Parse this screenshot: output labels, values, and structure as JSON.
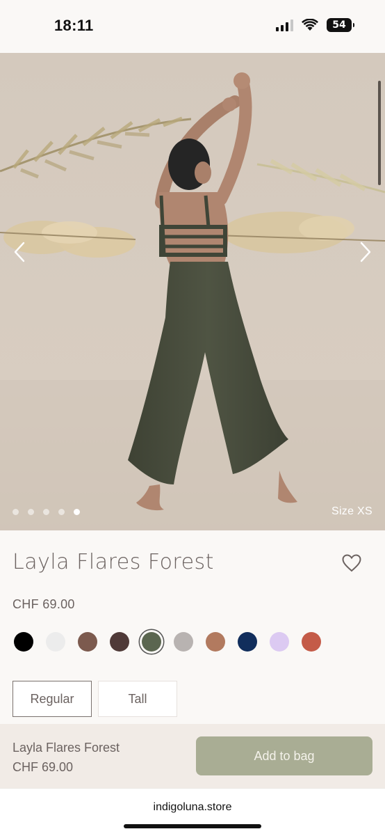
{
  "status_bar": {
    "time": "18:11",
    "battery_level": "54",
    "signal_icon": "cellular-signal-icon",
    "wifi_icon": "wifi-icon",
    "battery_icon": "battery-icon"
  },
  "gallery": {
    "size_label": "Size XS",
    "image_count": 5,
    "active_index": 4,
    "prev_icon": "chevron-left-icon",
    "next_icon": "chevron-right-icon"
  },
  "product": {
    "title": "Layla Flares Forest",
    "price": "CHF 69.00",
    "wishlist_icon": "heart-icon",
    "colors": [
      "#000000",
      "#ececec",
      "#7c5a4e",
      "#4f3a38",
      "#5b6650",
      "#b8b3b1",
      "#b27a5f",
      "#112e5c",
      "#dccaf2",
      "#c45b48"
    ],
    "selected_color_index": 4,
    "fit_options": [
      "Regular",
      "Tall"
    ],
    "selected_fit": "Regular"
  },
  "sticky_bar": {
    "name": "Layla Flares Forest",
    "price": "CHF 69.00",
    "add_button": "Add to bag",
    "accent_color": "#a9ad94"
  },
  "browser": {
    "url": "indigoluna.store"
  }
}
